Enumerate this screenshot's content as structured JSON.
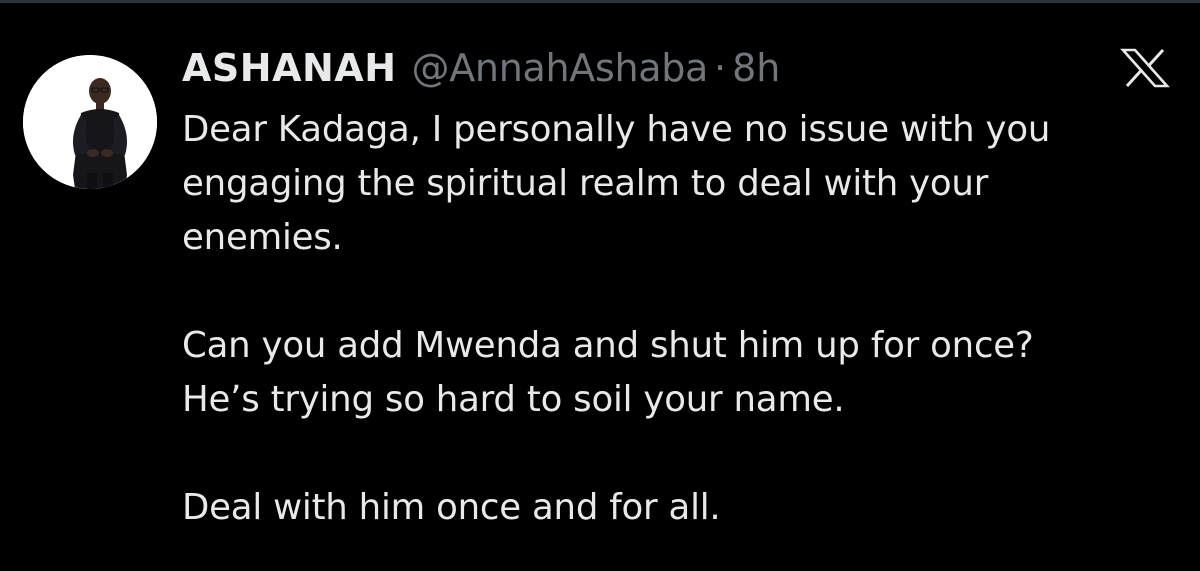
{
  "tweet": {
    "display_name": "ASHANAH",
    "handle": "@AnnahAshaba",
    "separator": "·",
    "time": "8h",
    "avatar_icon": "profile-photo",
    "platform_icon": "x-logo-icon",
    "paragraphs": [
      {
        "lines": [
          "Dear Kadaga, I personally have no issue with you",
          "engaging the spiritual realm to deal with your",
          "enemies."
        ]
      },
      {
        "lines": [
          "Can you add Mwenda and shut him up for once?",
          "He’s trying so hard to soil your name."
        ]
      },
      {
        "lines": [
          "Deal with him once and for all."
        ]
      }
    ]
  },
  "colors": {
    "background": "#000000",
    "primary_text": "#e7e9ea",
    "secondary_text": "#71767b",
    "divider": "#2f3336"
  }
}
